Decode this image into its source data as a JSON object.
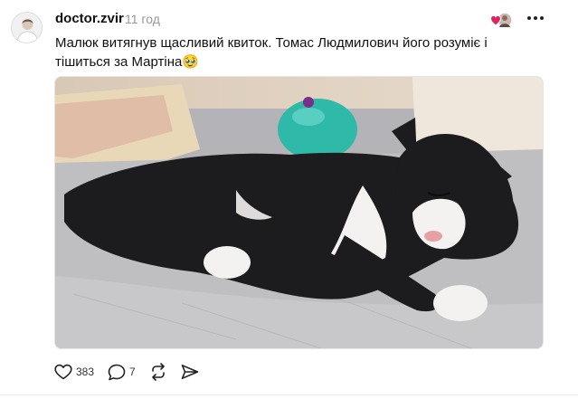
{
  "post": {
    "username": "doctor.zvir",
    "time": "11 год",
    "caption": "Малюк витягнув щасливий квиток. Томас Людмилович його розуміє і тішиться за Мартіна",
    "caption_emoji": "🥹",
    "likes": "383",
    "replies": "7"
  },
  "icons": {
    "avatar": "avatar",
    "activity": "liked-by-avatar-icon",
    "more": "more-horizontal-icon",
    "like": "heart-icon",
    "reply": "comment-bubble-icon",
    "repost": "repost-icon",
    "share": "send-icon"
  },
  "colors": {
    "text": "#111111",
    "muted": "#9a9a9a",
    "heart": "#e0245e"
  }
}
